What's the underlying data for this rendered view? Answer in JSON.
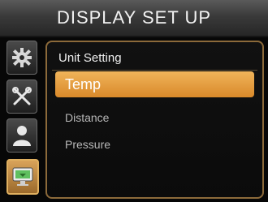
{
  "header": {
    "title": "DISPLAY SET UP"
  },
  "sidebar": {
    "tabs": [
      {
        "icon": "gear-icon"
      },
      {
        "icon": "tools-icon"
      },
      {
        "icon": "user-icon"
      },
      {
        "icon": "display-setup-icon",
        "active": true
      }
    ]
  },
  "panel": {
    "header": "Unit Setting",
    "items": [
      {
        "label": "Temp",
        "selected": true
      },
      {
        "label": "Distance"
      },
      {
        "label": "Pressure"
      }
    ]
  },
  "colors": {
    "accent": "#e39a3a",
    "panel_border": "#8c6a3a",
    "title_bar": "#3a3a3a",
    "text_light": "#f0f0f0",
    "text_dim": "#b8b8b8"
  }
}
